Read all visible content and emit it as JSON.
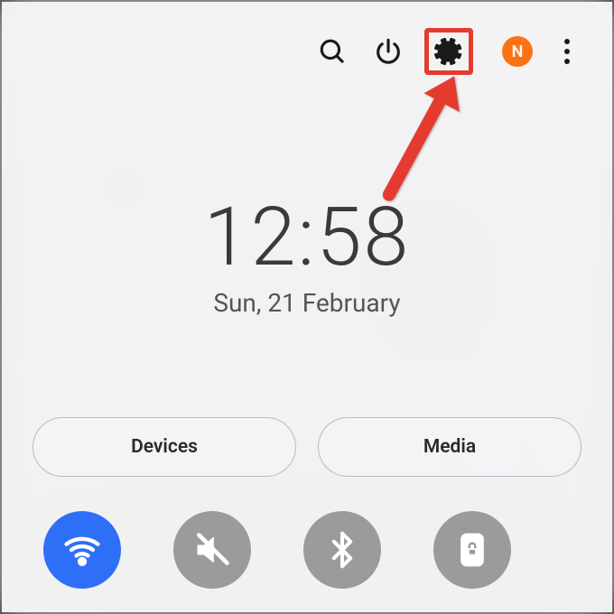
{
  "avatar_letter": "N",
  "clock": {
    "time": "12:58",
    "date": "Sun, 21 February"
  },
  "pills": {
    "devices": "Devices",
    "media": "Media"
  },
  "icons": {
    "search": "search-icon",
    "power": "power-icon",
    "settings": "gear-icon",
    "more": "more-icon"
  },
  "toggles": {
    "wifi": {
      "state": "active"
    },
    "mute": {
      "state": "inactive"
    },
    "bluetooth": {
      "state": "inactive"
    },
    "rotation_lock": {
      "state": "inactive"
    }
  },
  "annotation": {
    "highlight": "settings",
    "color": "#e43b2f"
  }
}
